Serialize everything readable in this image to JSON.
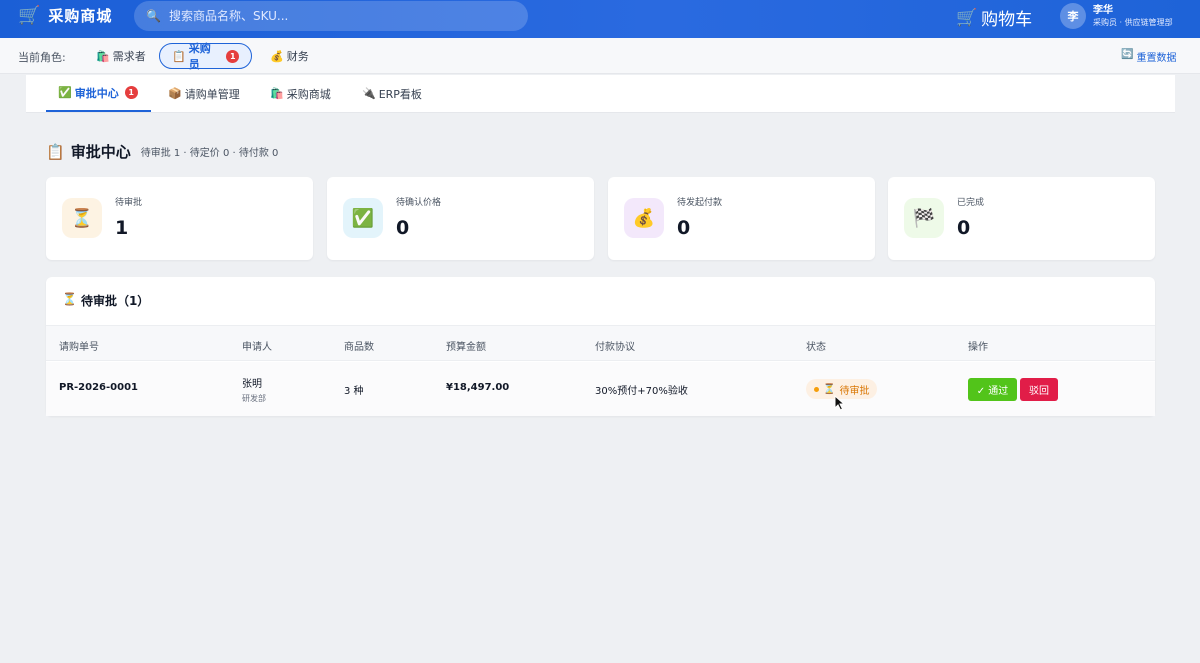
{
  "header": {
    "brand_icon": "cart-icon",
    "brand_title": "采购商城",
    "search_placeholder": "搜索商品名称、SKU...",
    "search_icon": "search-icon",
    "cart_label": "购物车",
    "user": {
      "avatar": "李",
      "name": "李华",
      "role": "采购员 · 供应链管理部"
    }
  },
  "rolebar": {
    "label": "当前角色:",
    "roles": [
      {
        "label": "需求者",
        "icon": "shopping-bag-icon"
      },
      {
        "label": "采购员",
        "icon": "clipboard-icon",
        "badge": "1",
        "active": true
      },
      {
        "label": "财务",
        "icon": "money-bag-icon"
      }
    ],
    "reset_label": "重置数据"
  },
  "tabs": [
    {
      "label": "审批中心",
      "icon": "check-box-icon",
      "badge": "1",
      "active": true
    },
    {
      "label": "请购单管理",
      "icon": "package-icon"
    },
    {
      "label": "采购商城",
      "icon": "shopping-bag-icon"
    },
    {
      "label": "ERP看板",
      "icon": "plug-icon"
    }
  ],
  "section": {
    "title": "审批中心",
    "summary": "待审批 1 · 待定价 0 · 待付款 0"
  },
  "stats": [
    {
      "label": "待审批",
      "value": "1",
      "icon": "hourglass-icon",
      "bg": "#fdf3e3"
    },
    {
      "label": "待确认价格",
      "value": "0",
      "icon": "check-box-icon",
      "bg": "#e3f4fb"
    },
    {
      "label": "待发起付款",
      "value": "0",
      "icon": "money-bag-icon",
      "bg": "#f3e8fb"
    },
    {
      "label": "已完成",
      "value": "0",
      "icon": "checkered-flag-icon",
      "bg": "#eefae8"
    }
  ],
  "pending": {
    "title": "待审批（1）",
    "columns": [
      "请购单号",
      "申请人",
      "商品数",
      "预算金额",
      "付款协议",
      "状态",
      "操作"
    ],
    "rows": [
      {
        "id": "PR-2026-0001",
        "applicant": "张明",
        "dept": "研发部",
        "items": "3 种",
        "amount": "¥18,497.00",
        "terms": "30%预付+70%验收",
        "status": "待审批",
        "approve": "✓ 通过",
        "reject": "驳回"
      }
    ]
  },
  "colors": {
    "primary": "#1e63d8",
    "approve": "#52c41a",
    "reject": "#e11d48",
    "status_pending": "#d97706"
  }
}
